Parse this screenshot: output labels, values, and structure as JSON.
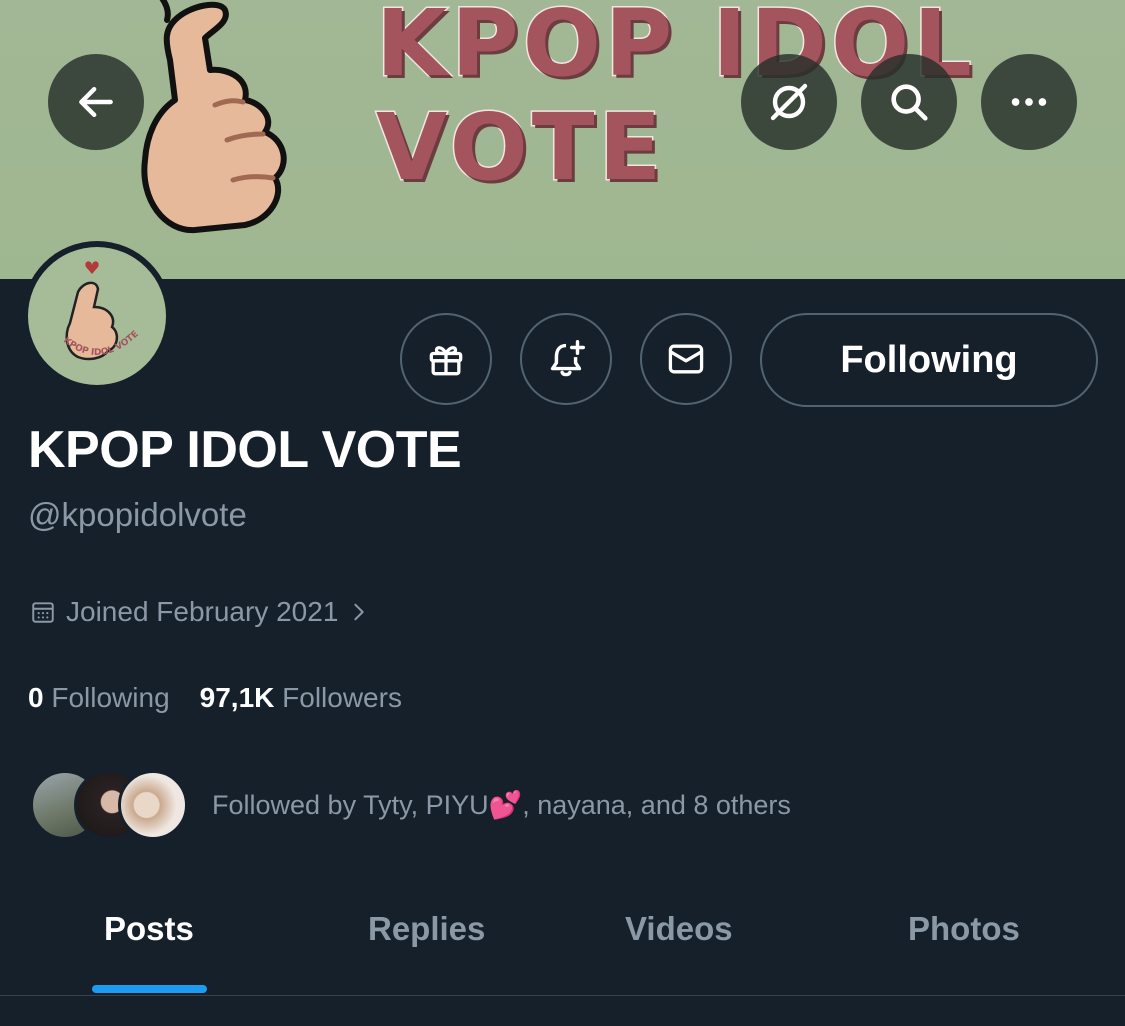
{
  "banner": {
    "text_line1": "KPOP IDOL",
    "text_line2": "VOTE"
  },
  "header_icons": {
    "back": "arrow-left-icon",
    "grok": "grok-icon",
    "search": "search-icon",
    "more": "more-icon"
  },
  "profile": {
    "avatar_label": "KPOP IDOL VOTE",
    "name": "KPOP IDOL VOTE",
    "handle": "@kpopidolvote",
    "joined": "Joined February 2021",
    "following_count": "0",
    "following_label": "Following",
    "followers_count": "97,1K",
    "followers_label": "Followers",
    "followed_by": "Followed by Tyty, PIYU💕, nayana, and 8 others"
  },
  "actions": {
    "gift": "gift-icon",
    "notify": "bell-plus-icon",
    "message": "envelope-icon",
    "following_button": "Following"
  },
  "tabs": [
    "Posts",
    "Replies",
    "Videos",
    "Photos"
  ],
  "colors": {
    "background": "#15202b",
    "accent": "#1d9bf0",
    "secondary_text": "#8b98a5",
    "banner": "#a2b795",
    "banner_text": "#a4545d"
  }
}
